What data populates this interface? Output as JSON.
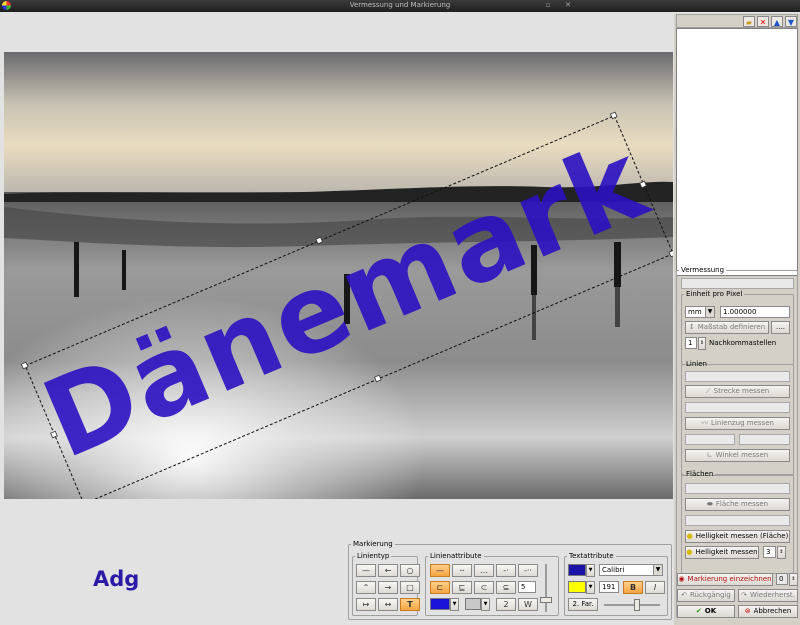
{
  "window": {
    "title": "Vermessung und Markierung"
  },
  "photo": {
    "watermark_text": "Dänemark",
    "caption": "Adg"
  },
  "list_toolbar": {
    "icons": [
      "folder-open-icon",
      "delete-icon",
      "move-up-icon",
      "move-down-icon"
    ]
  },
  "vermessung": {
    "label": "Vermessung",
    "einheit": {
      "label": "Einheit pro Pixel",
      "unit": "mm",
      "value": "1.000000",
      "scale_button": "Maßstab definieren",
      "more_button": "....",
      "decimals": "1",
      "decimals_label": "Nachkommastellen"
    },
    "linien": {
      "label": "Linien",
      "strecke_button": "Strecke messen",
      "linienzug_button": "Linienzug messen",
      "winkel_button": "Winkel messen"
    },
    "flaechen": {
      "label": "Flächen",
      "flaeche_button": "Fläche messen",
      "hell_flaeche_button": "Helligkeit messen (Fläche)",
      "hell_button": "Helligkeit messen",
      "hell_value": "3"
    }
  },
  "actions": {
    "markierung_button": "Markierung einzeichnen",
    "markierung_value": "0",
    "undo_button": "Rückgängig",
    "redo_button": "Wiederherst.",
    "ok_button": "OK",
    "cancel_button": "Abbrechen"
  },
  "markierung": {
    "label": "Markierung",
    "linientyp_label": "Linientyp",
    "linienattribute_label": "Linienattribute",
    "line_width": "5",
    "btn_2": "2",
    "btn_w": "W",
    "textattribute_label": "Textattribute",
    "font": "Calibri",
    "font_size": "191",
    "bold": "B",
    "italic": "I",
    "second_color": "2. Far.",
    "colors": {
      "line_color": "#1a13d8",
      "text_color": "#1a13a8",
      "bg_color": "#ffff00",
      "active": "#f3a443"
    }
  }
}
